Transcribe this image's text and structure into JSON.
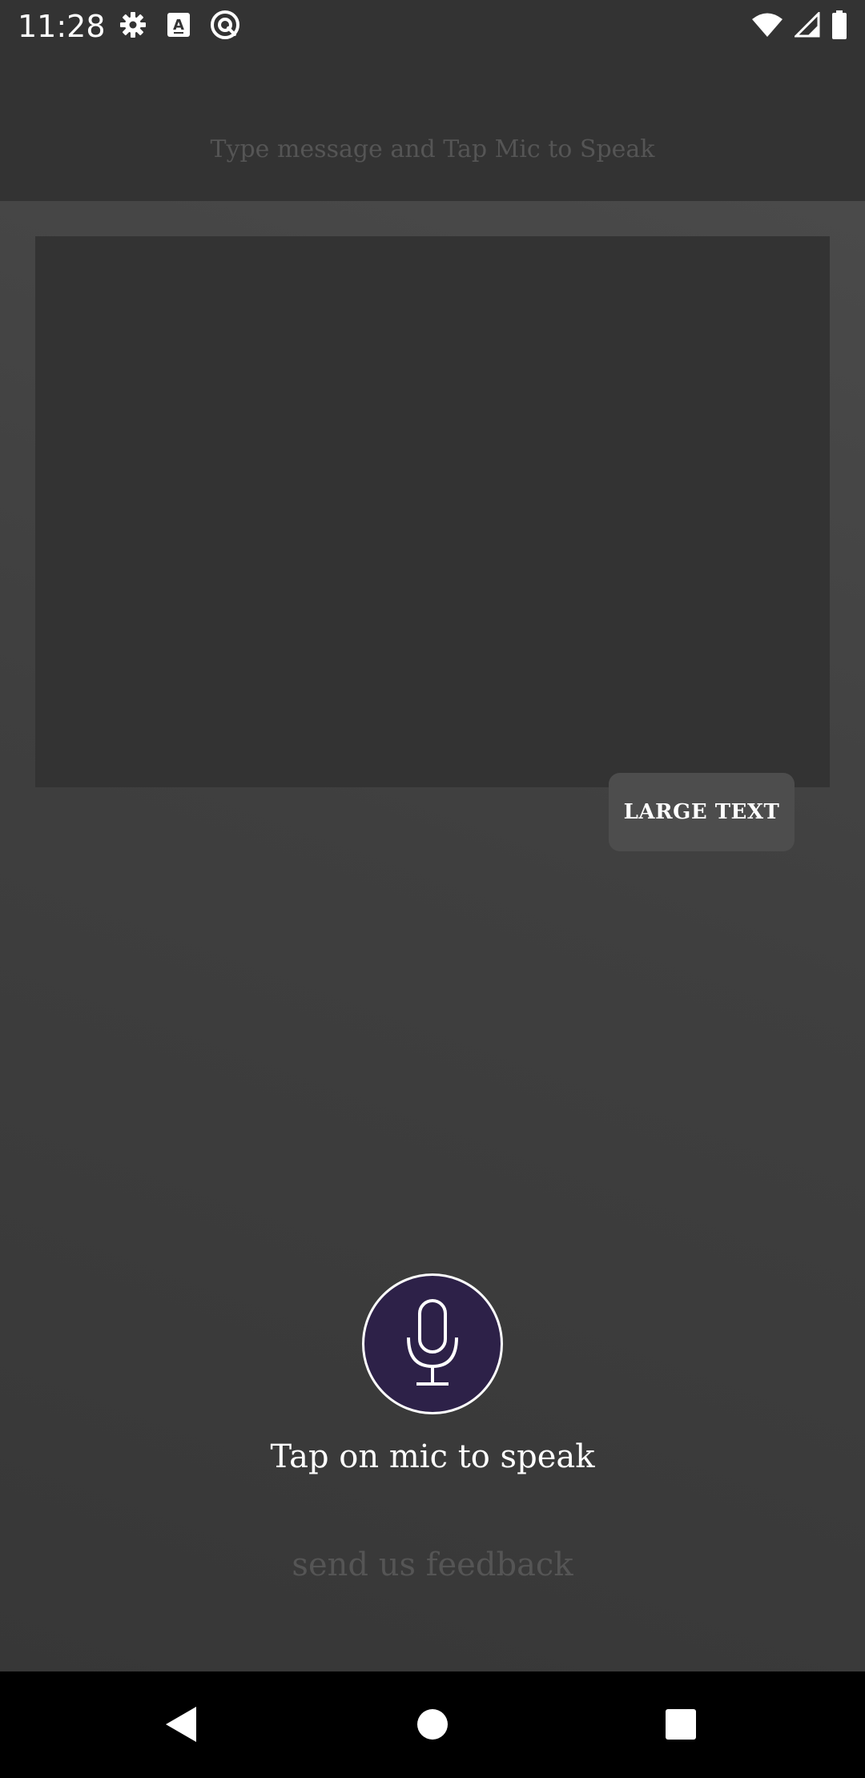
{
  "status_bar": {
    "time": "11:28",
    "left_icons": [
      "gear-icon",
      "a-box-icon",
      "circle-q-icon"
    ],
    "right_icons": [
      "wifi-icon",
      "signal-icon",
      "battery-icon"
    ]
  },
  "header": {
    "input_value": "",
    "input_placeholder": "Type message and Tap Mic to Speak"
  },
  "main": {
    "large_text_label": "LARGE TEXT",
    "mic_caption": "Tap on mic to speak",
    "feedback_label": "send us feedback"
  },
  "nav_bar": {
    "icons": [
      "back-icon",
      "home-icon",
      "recents-icon"
    ]
  },
  "colors": {
    "background": "#333333",
    "mic_fill": "#2d2148",
    "button_fill": "#4d4d4d",
    "muted_text": "#555555",
    "text": "#ffffff"
  }
}
